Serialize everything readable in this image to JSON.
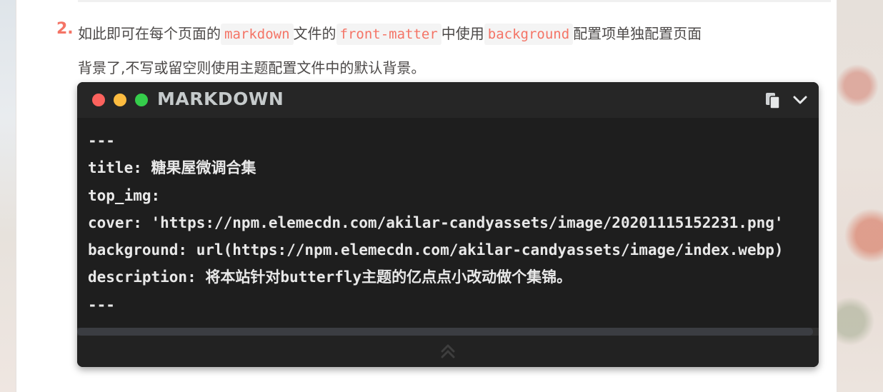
{
  "list_item": {
    "number": "2.",
    "line1": [
      {
        "text": "如此即可在每个页面的"
      },
      {
        "code": "markdown"
      },
      {
        "text": "文件的"
      },
      {
        "code": "front-matter"
      },
      {
        "text": "中使用"
      },
      {
        "code": "background"
      },
      {
        "text": "配置项单独配置页面"
      }
    ],
    "line2": "背景了,不写或留空则使用主题配置文件中的默认背景。"
  },
  "code_block": {
    "language": "MARKDOWN",
    "lines": [
      "---",
      "title: 糖果屋微调合集",
      "top_img:",
      "cover: 'https://npm.elemecdn.com/akilar-candyassets/image/20201115152231.png'",
      "background: url(https://npm.elemecdn.com/akilar-candyassets/image/index.webp)",
      "description: 将本站针对butterfly主题的亿点点小改动做个集锦。",
      "---"
    ],
    "icons": {
      "copy": "copy-icon",
      "expand": "chevron-down-icon",
      "collapse": "double-chevron-up-icon"
    },
    "colors": {
      "window_red": "#fc625d",
      "window_yellow": "#fdbc40",
      "window_green": "#35cd4b",
      "inline_code": "#f47466"
    }
  }
}
